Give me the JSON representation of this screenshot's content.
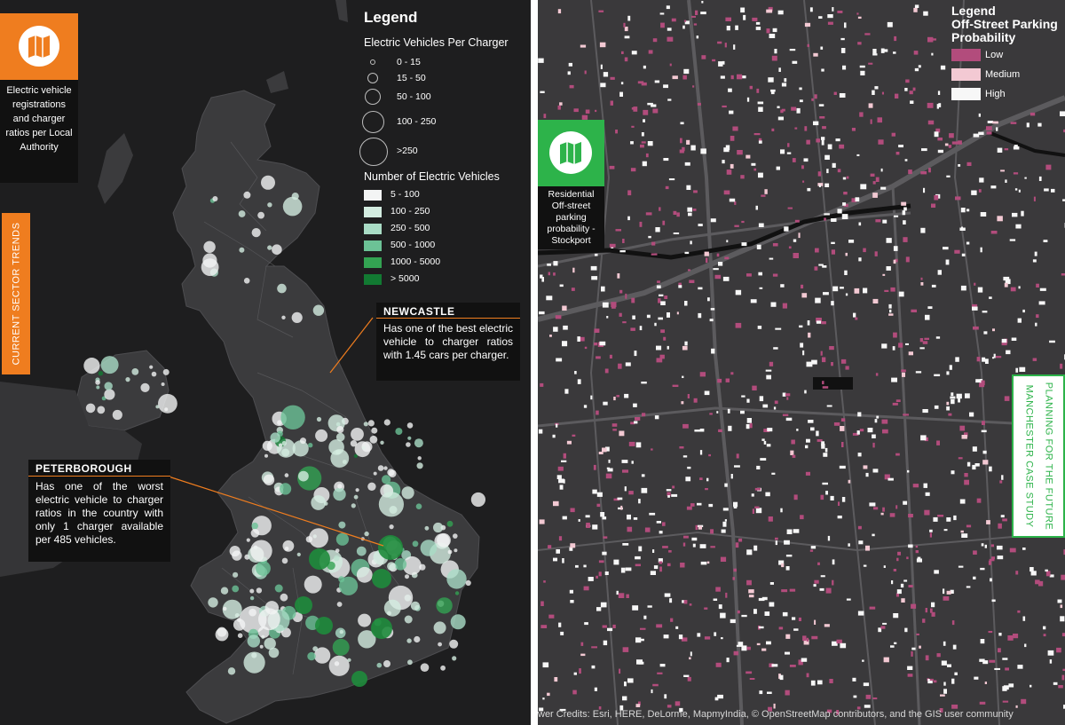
{
  "left_panel": {
    "legend": {
      "title": "Legend",
      "ratio_heading": "Electric Vehicles Per Charger",
      "ratio_classes": [
        "0 - 15",
        "15 - 50",
        "50 - 100",
        "100 - 250",
        ">250"
      ],
      "count_heading": "Number of Electric Vehicles",
      "count_classes": [
        "5 - 100",
        "100 - 250",
        "250 - 500",
        "500 - 1000",
        "1000 - 5000",
        "> 5000"
      ],
      "count_colors": [
        "#f3f4f4",
        "#d3ece0",
        "#a9dcc5",
        "#6cc296",
        "#33a352",
        "#127a32"
      ]
    },
    "badge": {
      "icon": "map-icon",
      "color": "#ef7d1f",
      "caption": "Electric vehicle registrations and charger ratios per Local Authority"
    },
    "side_tab": "CURRENT SECTOR TRENDS",
    "newcastle": {
      "title": "NEWCASTLE",
      "text": "Has one of the best electric vehicle to charger ratios with 1.45 cars per charger."
    },
    "peterborough": {
      "title": "PETERBOROUGH",
      "text": "Has one of the worst electric vehicle to charger ratios in the country with only 1 charger available per 485 vehicles."
    }
  },
  "right_panel": {
    "legend": {
      "title_line1": "Legend",
      "title_line2": "Off-Street Parking",
      "title_line3": "Probability",
      "classes": [
        "Low",
        "Medium",
        "High"
      ],
      "colors": [
        "#b24c7c",
        "#f3c9d3",
        "#f7f7f7"
      ]
    },
    "badge": {
      "icon": "map-icon",
      "color": "#2db34a",
      "caption": "Residential Off-street parking probability - Stockport"
    },
    "side_tab": {
      "line1": "PLANNING FOR THE FUTURE",
      "line2": "MANCHESTER CASE STUDY"
    },
    "credits": "wer Credits: Esri, HERE, DeLorme, MapmyIndia, © OpenStreetMap contributors, and the GIS user community"
  }
}
